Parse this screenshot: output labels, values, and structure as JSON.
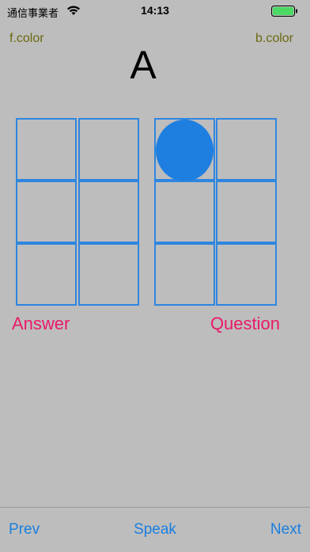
{
  "status_bar": {
    "carrier": "通信事業者",
    "time": "14:13",
    "battery_color": "#4cd964"
  },
  "header": {
    "fcolor_label": "f.color",
    "bcolor_label": "b.color",
    "letter": "A"
  },
  "braille": {
    "cells": 12,
    "raised_dots": [
      1
    ],
    "dot_color": "#1f7fe0",
    "border_color": "#2e86e0"
  },
  "labels": {
    "answer": "Answer",
    "question": "Question"
  },
  "toolbar": {
    "prev_label": "Prev",
    "speak_label": "Speak",
    "next_label": "Next"
  }
}
